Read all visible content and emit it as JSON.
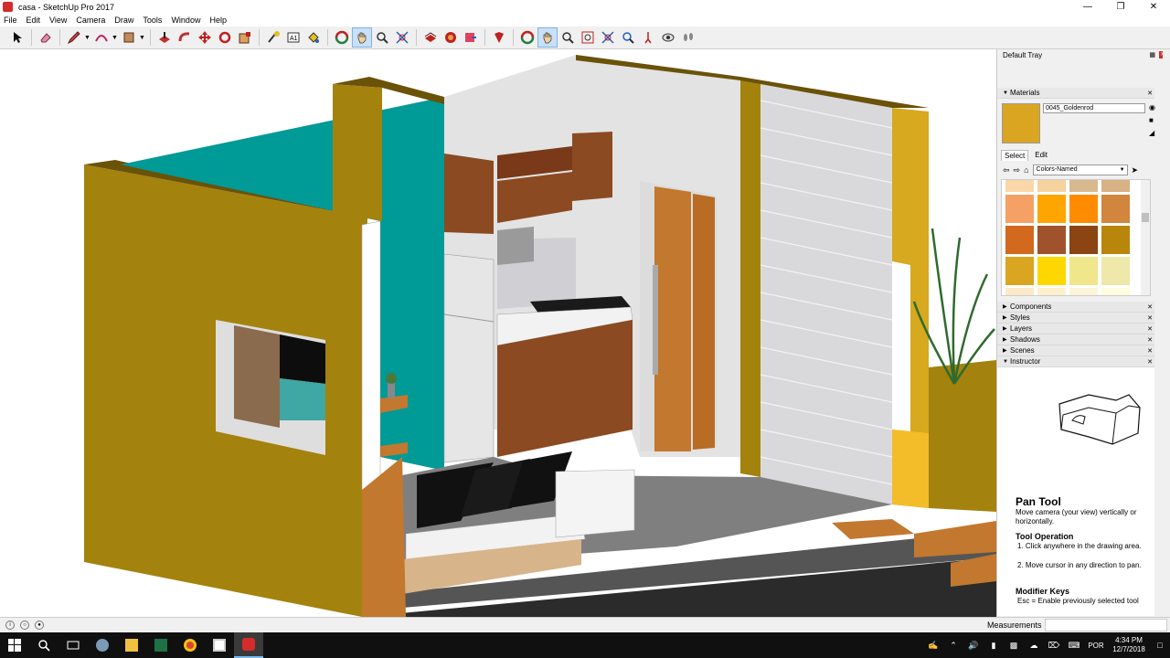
{
  "window": {
    "title": "casa - SketchUp Pro 2017",
    "language": "POR"
  },
  "menu": [
    "File",
    "Edit",
    "View",
    "Camera",
    "Draw",
    "Tools",
    "Window",
    "Help"
  ],
  "toolbar": {
    "tools": [
      "select-tool",
      "eraser-tool",
      "line-tool",
      "arc-tool",
      "shape-tool",
      "push-pull-tool",
      "follow-me-tool",
      "move-tool",
      "rotate-tool",
      "scale-tool",
      "tape-measure-tool",
      "text-tool",
      "paint-bucket-tool",
      "orbit-tool",
      "pan-tool",
      "zoom-tool",
      "zoom-extents-tool",
      "warehouse-tool",
      "extension-warehouse-tool",
      "send-to-layout-tool",
      "extension-manager-tool",
      "orbit-tool-2",
      "pan-tool-2",
      "zoom-tool-2",
      "zoom-window-tool",
      "zoom-extents-tool-2",
      "previous-view-tool",
      "position-camera-tool",
      "look-around-tool",
      "walk-tool"
    ]
  },
  "tray": {
    "title": "Default Tray",
    "materials": {
      "label": "Materials",
      "current_name": "0045_Goldenrod",
      "current_color": "#daa520",
      "tabs": [
        "Select",
        "Edit"
      ],
      "library": "Colors-Named",
      "swatches": [
        [
          "#f9d7a8",
          "#f5d39e",
          "#d7b98f",
          "#d8b185"
        ],
        [
          "#f5a165",
          "#ffa500",
          "#ff8c00",
          "#d2853d"
        ],
        [
          "#d2691e",
          "#a0522d",
          "#8b4513",
          "#b8860b"
        ],
        [
          "#daa520",
          "#ffd700",
          "#f0e68c",
          "#eee8aa"
        ],
        [
          "#fbe9c8",
          "#fff0cc",
          "#fdf5d9",
          "#fffce0"
        ]
      ]
    },
    "panels": [
      "Components",
      "Styles",
      "Layers",
      "Shadows",
      "Scenes",
      "Instructor"
    ],
    "instructor": {
      "tool_name": "Pan Tool",
      "description": "Move camera (your view) vertically or horizontally.",
      "operation_title": "Tool Operation",
      "operation_steps": [
        "1. Click anywhere in the drawing area.",
        "2. Move cursor in any direction to pan."
      ],
      "modifier_title": "Modifier Keys",
      "modifier_text": "Esc = Enable previously selected tool"
    }
  },
  "status": {
    "measurements_label": "Measurements"
  },
  "taskbar": {
    "time": "4:34 PM",
    "date": "12/7/2018"
  },
  "colors": {
    "wall_gold": "#a4820e",
    "teal": "#009a97",
    "wood": "#c2782e"
  }
}
